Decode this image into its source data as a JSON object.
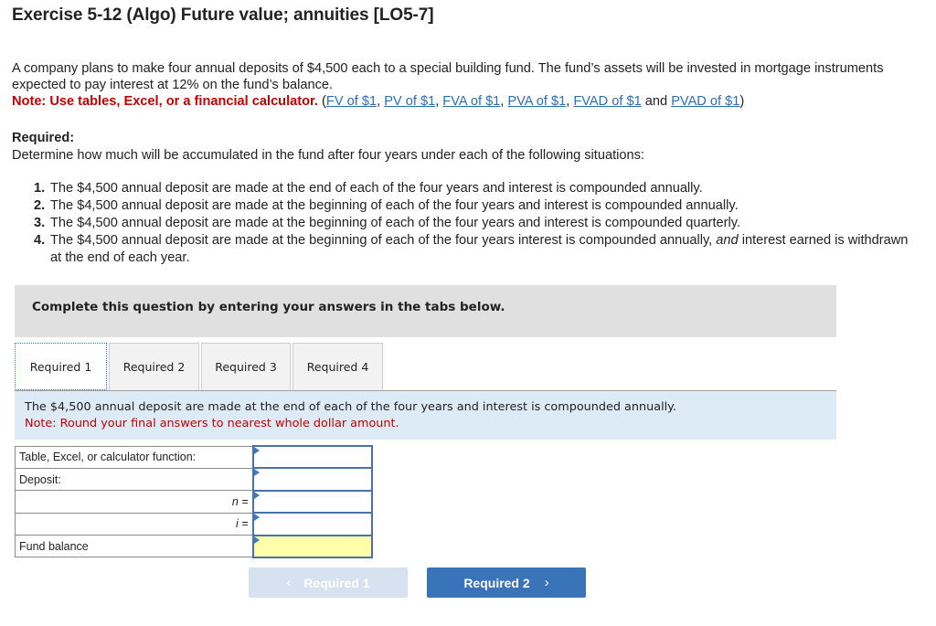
{
  "title": "Exercise 5-12 (Algo) Future value; annuities [LO5-7]",
  "intro": {
    "text": "A company plans to make four annual deposits of $4,500 each to a special building fund. The fund’s assets will be invested in mortgage instruments expected to pay interest at 12% on the fund’s balance.",
    "note": "Note: Use tables, Excel, or a financial calculator.",
    "paren_open": "(",
    "links": [
      "FV of $1",
      "PV of $1",
      "FVA of $1",
      "PVA of $1",
      "FVAD of $1",
      "PVAD of $1"
    ],
    "sep": ", ",
    "and_word": " and ",
    "paren_close": ")"
  },
  "required": {
    "heading": "Required:",
    "description": "Determine how much will be accumulated in the fund after four years under each of the following situations:",
    "items": [
      {
        "num": "1.",
        "text": "The $4,500 annual deposit are made at the end of each of the four years  and interest is compounded annually."
      },
      {
        "num": "2.",
        "text": "The $4,500 annual deposit are made at the beginning of each of the four years and interest is compounded annually."
      },
      {
        "num": "3.",
        "text": "The $4,500 annual deposit are made at the beginning of each of the four years and interest is compounded quarterly."
      },
      {
        "num": "4.",
        "text_before": "The $4,500 annual deposit are made at the beginning of each of the four years interest is compounded annually, ",
        "text_italic": "and",
        "text_after": " interest earned is withdrawn at the end of each year."
      }
    ]
  },
  "instructions": "Complete this question by entering your answers in the tabs below.",
  "tabs": [
    {
      "label": "Required 1",
      "active": true
    },
    {
      "label": "Required 2",
      "active": false
    },
    {
      "label": "Required 3",
      "active": false
    },
    {
      "label": "Required 4",
      "active": false
    }
  ],
  "panel": {
    "description": "The $4,500 annual deposit are made at the end of each of the four years and interest is compounded annually.",
    "note": "Note: Round your final answers to nearest whole dollar amount."
  },
  "answer_table": {
    "rows": [
      {
        "label": "Table, Excel, or calculator function:",
        "value": ""
      },
      {
        "label": "Deposit:",
        "value": ""
      },
      {
        "label": "n =",
        "value": ""
      },
      {
        "label": "i =",
        "value": ""
      },
      {
        "label": "Fund balance",
        "value": ""
      }
    ]
  },
  "nav": {
    "prev_label": "Required 1",
    "next_label": "Required 2",
    "prev_icon": "‹",
    "next_icon": "›"
  },
  "colors": {
    "note_red": "#c00000",
    "link_blue": "#2a6fb6",
    "panel_bg": "#ddebf7",
    "next_button": "#3a74b8",
    "prev_button_disabled": "#d6e2f0",
    "answer_highlight": "#ffffaa"
  }
}
